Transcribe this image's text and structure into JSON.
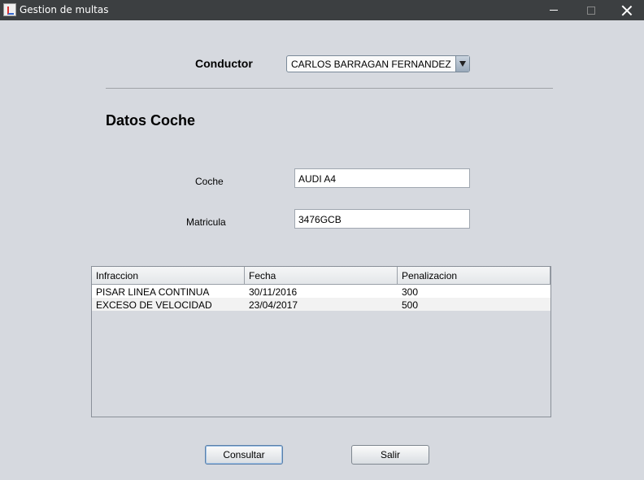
{
  "window": {
    "title": "Gestion de multas"
  },
  "form": {
    "conductor_label": "Conductor",
    "conductor_selected": "CARLOS BARRAGAN FERNANDEZ",
    "section_title": "Datos Coche",
    "coche_label": "Coche",
    "coche_value": "AUDI A4",
    "matricula_label": "Matricula",
    "matricula_value": "3476GCB"
  },
  "table": {
    "columns": [
      "Infraccion",
      "Fecha",
      "Penalizacion"
    ],
    "rows": [
      [
        "PISAR LINEA CONTINUA",
        "30/11/2016",
        "300"
      ],
      [
        "EXCESO DE VELOCIDAD",
        "23/04/2017",
        "500"
      ]
    ]
  },
  "buttons": {
    "consultar": "Consultar",
    "salir": "Salir"
  }
}
